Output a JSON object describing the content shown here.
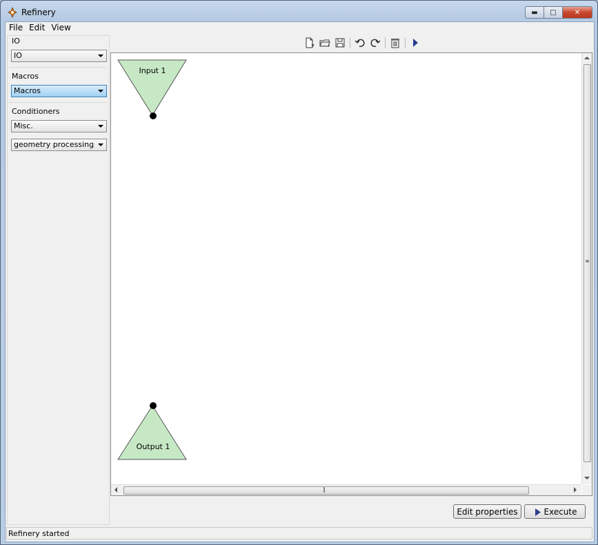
{
  "window": {
    "title": "Refinery"
  },
  "menu": {
    "items": [
      "File",
      "Edit",
      "View"
    ]
  },
  "left_panel": {
    "io_label": "IO",
    "io_value": "IO",
    "macros_label": "Macros",
    "macros_value": "Macros",
    "conditioners_label": "Conditioners",
    "misc_value": "Misc.",
    "geometry_value": "geometry processing"
  },
  "toolbar": {
    "icons": [
      "new-file-icon",
      "open-folder-icon",
      "save-icon",
      "undo-icon",
      "redo-icon",
      "delete-icon",
      "run-icon"
    ]
  },
  "canvas": {
    "nodes": [
      {
        "label": "Input 1",
        "kind": "input",
        "fill": "#c7e8c5"
      },
      {
        "label": "Output 1",
        "kind": "output",
        "fill": "#c7e8c5"
      }
    ]
  },
  "buttons": {
    "edit_properties": "Edit properties",
    "execute": "Execute"
  },
  "status": {
    "text": "Refinery started"
  },
  "colors": {
    "accent": "#3c7fb1",
    "node_fill": "#c7e8c5",
    "run_arrow": "#2c3e8c"
  }
}
